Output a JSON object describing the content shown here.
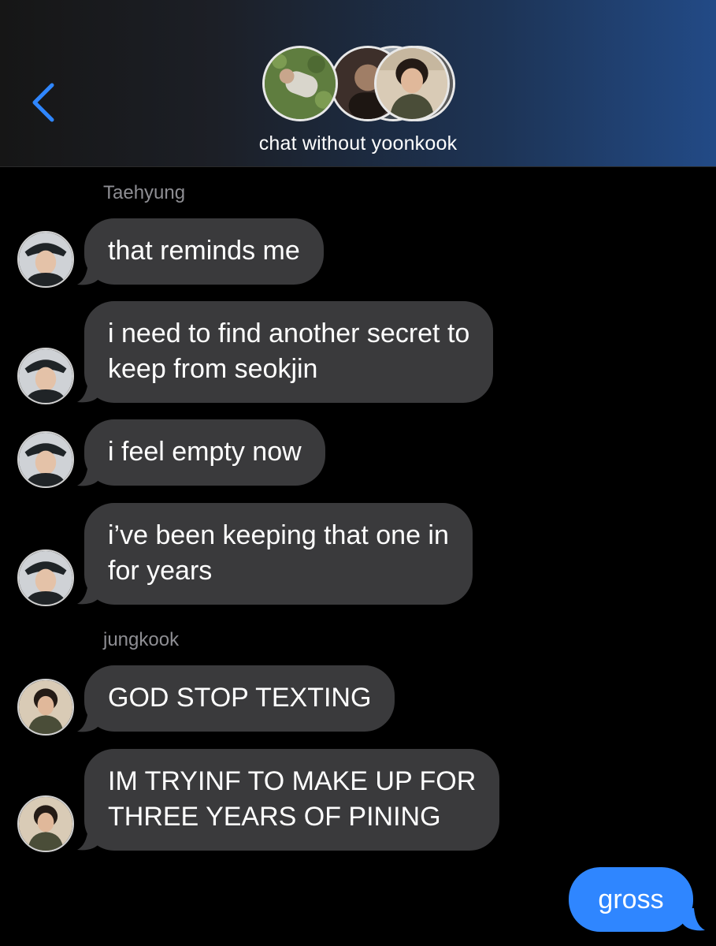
{
  "header": {
    "title": "chat without yoonkook",
    "back_icon": "chevron-left-icon",
    "back_color": "#2f86ff",
    "member_avatars": [
      "avatar-1",
      "avatar-2",
      "avatar-3",
      "avatar-4",
      "avatar-5"
    ]
  },
  "groups": [
    {
      "sender": "Taehyung",
      "messages": [
        "that reminds me",
        "i need to find another secret to",
        "keep from seokjin",
        "i feel empty now",
        "i’ve been keeping that one in",
        "for years"
      ]
    },
    {
      "sender": "jungkook",
      "messages": [
        "GOD STOP TEXTING",
        "IM TRYINF TO MAKE UP FOR",
        "THREE YEARS OF PINING"
      ]
    }
  ],
  "outgoing": {
    "text": "gross",
    "color": "#2f86ff"
  },
  "colors": {
    "incoming_bubble": "#3a3a3c",
    "sender_label": "#8e8e93",
    "background": "#000000"
  }
}
